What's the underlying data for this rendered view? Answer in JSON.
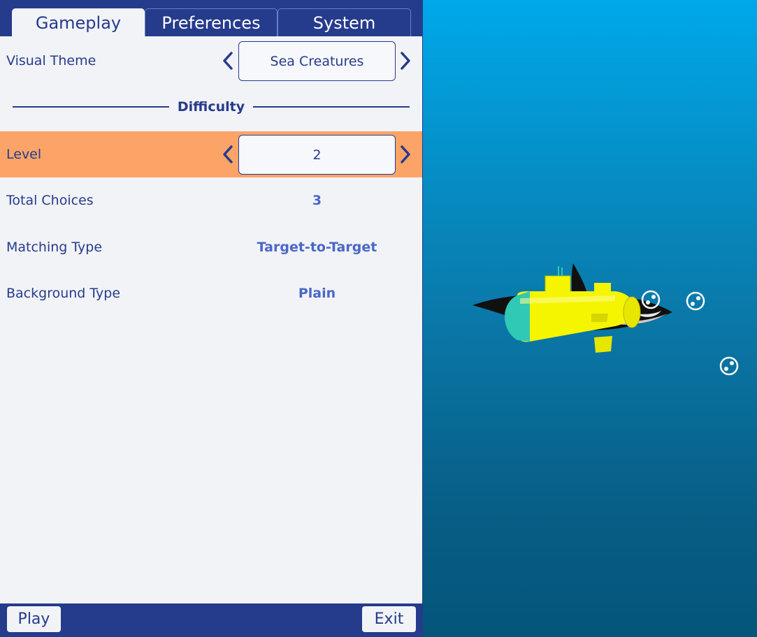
{
  "tabs": [
    {
      "label": "Gameplay",
      "active": true
    },
    {
      "label": "Preferences",
      "active": false
    },
    {
      "label": "System",
      "active": false
    }
  ],
  "settings": {
    "visual_theme": {
      "label": "Visual Theme",
      "value": "Sea Creatures"
    },
    "section_title": "Difficulty",
    "level": {
      "label": "Level",
      "value": "2"
    },
    "total_choices": {
      "label": "Total Choices",
      "value": "3"
    },
    "matching_type": {
      "label": "Matching Type",
      "value": "Target-to-Target"
    },
    "background_type": {
      "label": "Background Type",
      "value": "Plain"
    }
  },
  "footer": {
    "play_label": "Play",
    "exit_label": "Exit"
  },
  "icons": {
    "prev": "chevron-left-icon",
    "next": "chevron-right-icon",
    "bubble": "bubble-icon",
    "submarine": "submarine-icon",
    "orca": "orca-icon"
  },
  "colors": {
    "panel_navy": "#253b8c",
    "panel_bg": "#f2f3f7",
    "highlight_row": "#fca468",
    "value_text": "#4a67c8",
    "water_top": "#00a8ea",
    "water_bottom": "#05557a",
    "submarine_yellow": "#f5f500",
    "submarine_teal": "#2fc9b5"
  }
}
